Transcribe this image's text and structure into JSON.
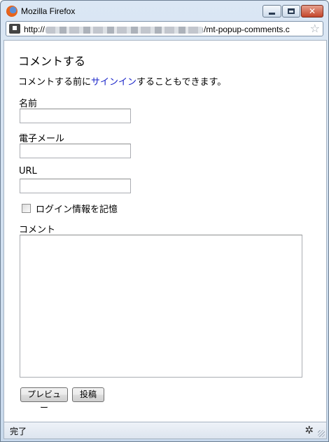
{
  "window": {
    "title": "Mozilla Firefox",
    "url_prefix": "http://",
    "url_suffix": "/mt-popup-comments.c"
  },
  "page": {
    "title": "コメントする",
    "intro_before": "コメントする前に",
    "intro_link": "サインイン",
    "intro_after": "することもできます。"
  },
  "form": {
    "name_label": "名前",
    "name_value": "",
    "email_label": "電子メール",
    "email_value": "",
    "url_label": "URL",
    "url_value": "",
    "remember_label": "ログイン情報を記憶",
    "remember_checked": false,
    "comment_label": "コメント",
    "comment_value": "",
    "preview_button": "プレビュー",
    "post_button": "投稿"
  },
  "status": {
    "text": "完了"
  },
  "icons": {
    "browser": "firefox-icon",
    "site": "site-favicon-icon",
    "bookmark": "star-icon",
    "status": "bug-icon"
  }
}
